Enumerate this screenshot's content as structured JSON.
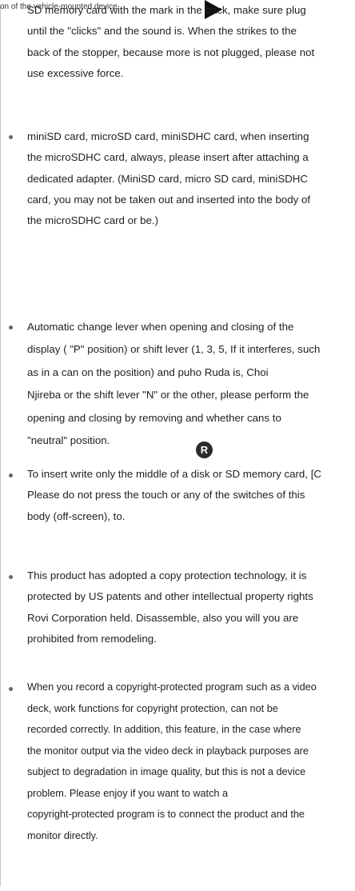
{
  "top_fragment": "on of the vehicle-mounted device",
  "items": [
    {
      "lines": [
        "SD memory card with the mark in the back, make sure plug",
        "until the \"clicks\" and the sound is. When the strikes to the",
        "back of the stopper, because more is not plugged, please not",
        "use excessive force."
      ]
    },
    {
      "lines": [
        "miniSD card, microSD card, miniSDHC card, when inserting",
        "the microSDHC card, always, please insert after attaching a",
        "dedicated adapter. (MiniSD card, micro SD card, miniSDHC",
        "card, you may not be taken out and inserted into the body of",
        "the microSDHC card or be.)"
      ]
    },
    {
      "lines": [
        "Automatic change lever when opening and closing of the",
        "display ( \"P\" position) or shift lever (1, 3, 5, If it interferes, such",
        "as in a can on the position) and  puho Ruda is, Choi",
        "Njireba or the shift lever \"N\" or the other, please perform the",
        "opening and closing by removing and whether cans to",
        "\"neutral\" position."
      ],
      "badge": "R"
    },
    {
      "lines": [
        "To insert write only the middle of a disk or SD memory card, [C",
        "Please do not press the touch or any of the switches of this",
        "body (off-screen), to."
      ]
    },
    {
      "lines": [
        "This product has adopted a copy protection technology, it is",
        "protected by US patents and other intellectual property rights",
        "Rovi Corporation held. Disassemble, also you will you are",
        "prohibited from remodeling."
      ]
    },
    {
      "lines": [
        "When you record a copyright-protected program such as a video",
        "deck, work functions for copyright protection, can not be",
        "recorded correctly. In addition, this feature, in the case where",
        "the monitor output via the video deck in playback purposes are",
        "subject to degradation in image quality, but this is not a device",
        "problem. Please enjoy if you want to watch a",
        "copyright-protected program is to connect the product and the",
        "monitor directly."
      ]
    }
  ]
}
